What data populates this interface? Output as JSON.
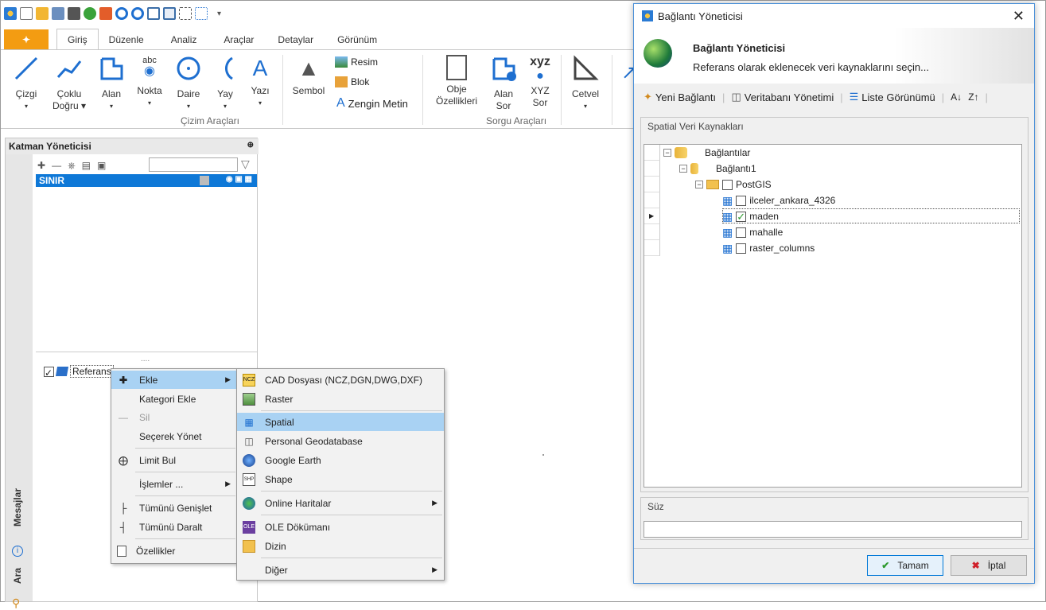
{
  "ribbon": {
    "tabs": [
      "Giriş",
      "Düzenle",
      "Analiz",
      "Araçlar",
      "Detaylar",
      "Görünüm"
    ],
    "active_tab": "Giriş",
    "buttons": {
      "cizgi": "Çizgi",
      "coklu": "Çoklu",
      "coklu2": "Doğru",
      "alan": "Alan",
      "nokta": "Nokta",
      "daire": "Daire",
      "yay": "Yay",
      "yazi": "Yazı",
      "sembol": "Sembol",
      "resim": "Resim",
      "blok": "Blok",
      "zengin": "Zengin Metin",
      "obje": "Obje",
      "obje2": "Özellikleri",
      "alansor": "Alan",
      "alansor2": "Sor",
      "xyz": "XYZ",
      "xyz2": "Sor",
      "cetvel": "Cetvel",
      "nokta_icon_text": "abc",
      "xyz_icon_text": "xyz"
    },
    "groups": {
      "cizim": "Çizim Araçları",
      "sorgu": "Sorgu Araçları"
    }
  },
  "layer_manager": {
    "title": "Katman Yöneticisi",
    "selected_layer": "SINIR",
    "ref_item": "Referans",
    "side_tabs": [
      "Mesajlar",
      "Ara"
    ]
  },
  "context_menu": {
    "items": [
      "Ekle",
      "Kategori Ekle",
      "Sil",
      "Seçerek Yönet",
      "Limit Bul",
      "İşlemler ...",
      "Tümünü Genişlet",
      "Tümünü Daralt",
      "Özellikler"
    ]
  },
  "submenu": {
    "items": [
      "CAD Dosyası (NCZ,DGN,DWG,DXF)",
      "Raster",
      "Spatial",
      "Personal Geodatabase",
      "Google Earth",
      "Shape",
      "Online Haritalar",
      "OLE Dökümanı",
      "Dizin",
      "Diğer"
    ]
  },
  "dialog": {
    "title": "Bağlantı Yöneticisi",
    "header_title": "Bağlantı Yöneticisi",
    "header_sub": "Referans olarak eklenecek veri kaynaklarını seçin...",
    "toolbar": [
      "Yeni Bağlantı",
      "Veritabanı Yönetimi",
      "Liste Görünümü"
    ],
    "group_label": "Spatial Veri Kaynakları",
    "tree": {
      "root": "Bağlantılar",
      "conn": "Bağlantı1",
      "db": "PostGIS",
      "tables": [
        {
          "name": "ilceler_ankara_4326",
          "checked": false
        },
        {
          "name": "maden",
          "checked": true
        },
        {
          "name": "mahalle",
          "checked": false
        },
        {
          "name": "raster_columns",
          "checked": false
        }
      ]
    },
    "filter_label": "Süz",
    "ok": "Tamam",
    "cancel": "İptal"
  }
}
